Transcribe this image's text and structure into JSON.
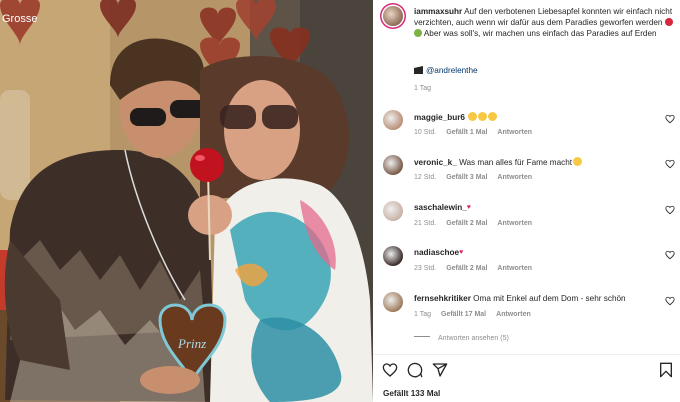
{
  "post": {
    "username": "iammaxsuhr",
    "caption": "Auf den verbotenen Liebesapfel konnten wir einfach nicht verzichten, auch wenn wir dafür aus dem Paradies geworfen werden",
    "caption_end": "Aber was soll's, wir machen uns einfach das Paradies auf Erden",
    "credit_handle": "@andrelenthe",
    "time": "1 Tag",
    "cookie_heart_text": "Prinz",
    "photo_sign_text": "Grosse"
  },
  "comments": [
    {
      "user": "maggie_bur6",
      "text": "",
      "emojis": 3,
      "time": "10 Std.",
      "likes": "Gefällt 1 Mal",
      "reply": "Antworten",
      "avatar": "#b89078"
    },
    {
      "user": "veronic_k_",
      "text": "Was man alles für Fame macht",
      "emojis": 1,
      "time": "12 Std.",
      "likes": "Gefällt 3 Mal",
      "reply": "Antworten",
      "avatar": "#7a5a48"
    },
    {
      "user": "saschalewin_",
      "text": "",
      "heart": true,
      "time": "21 Std.",
      "likes": "Gefällt 2 Mal",
      "reply": "Antworten",
      "avatar": "#c9b2a6"
    },
    {
      "user": "nadiaschoe",
      "text": "",
      "heart": true,
      "time": "23 Std.",
      "likes": "Gefällt 2 Mal",
      "reply": "Antworten",
      "avatar": "#3b2e2a"
    },
    {
      "user": "fernsehkritiker",
      "text": "Oma mit Enkel auf dem Dom - sehr schön",
      "emojis": 0,
      "time": "1 Tag",
      "likes": "Gefällt 17 Mal",
      "reply": "Antworten",
      "avatar": "#a07a5c"
    }
  ],
  "more_replies": "Antworten ansehen (5)",
  "likes_total": "Gefällt 133 Mal",
  "icons": [
    "heart-icon",
    "comment-icon",
    "share-icon",
    "bookmark-icon",
    "clapperboard-icon"
  ],
  "colors": {
    "link": "#00376b",
    "meta": "#8e8e8e",
    "story_ring": "#d62976"
  }
}
